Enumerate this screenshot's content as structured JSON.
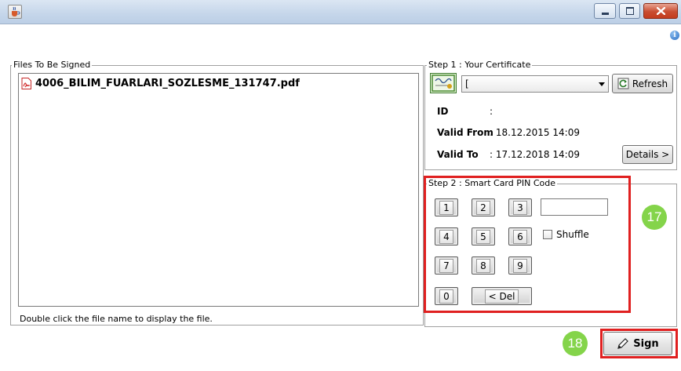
{
  "window": {
    "title": "",
    "controls": [
      "minimize",
      "maximize",
      "close"
    ],
    "icons": {
      "app": "java-cup-icon",
      "info": "info-icon"
    },
    "info_glyph": "i"
  },
  "files_group": {
    "legend": "Files To Be Signed",
    "files": [
      {
        "name": "4006_BILIM_FUARLARI_SOZLESME_131747.pdf",
        "icon": "pdf-icon"
      }
    ],
    "hint": "Double click the file name to display the file."
  },
  "certificate_group": {
    "legend": "Step 1 : Your Certificate",
    "combo_value": "[",
    "refresh_label": "Refresh",
    "id_label": "ID",
    "id_value": ":",
    "valid_from_label": "Valid From",
    "valid_from_value": ": 18.12.2015 14:09",
    "valid_to_label": "Valid To",
    "valid_to_value": ": 17.12.2018 14:09",
    "details_label": "Details >"
  },
  "pin_group": {
    "legend": "Step 2 : Smart Card PIN Code",
    "keys": [
      "1",
      "2",
      "3",
      "4",
      "5",
      "6",
      "7",
      "8",
      "9",
      "0"
    ],
    "del_label": "< Del",
    "pin_value": "",
    "shuffle_label": "Shuffle",
    "shuffle_checked": false
  },
  "annotations": {
    "step_pin": "17",
    "step_sign": "18",
    "highlight_color": "#e02020",
    "badge_color": "#84d44a"
  },
  "sign_label": "Sign"
}
